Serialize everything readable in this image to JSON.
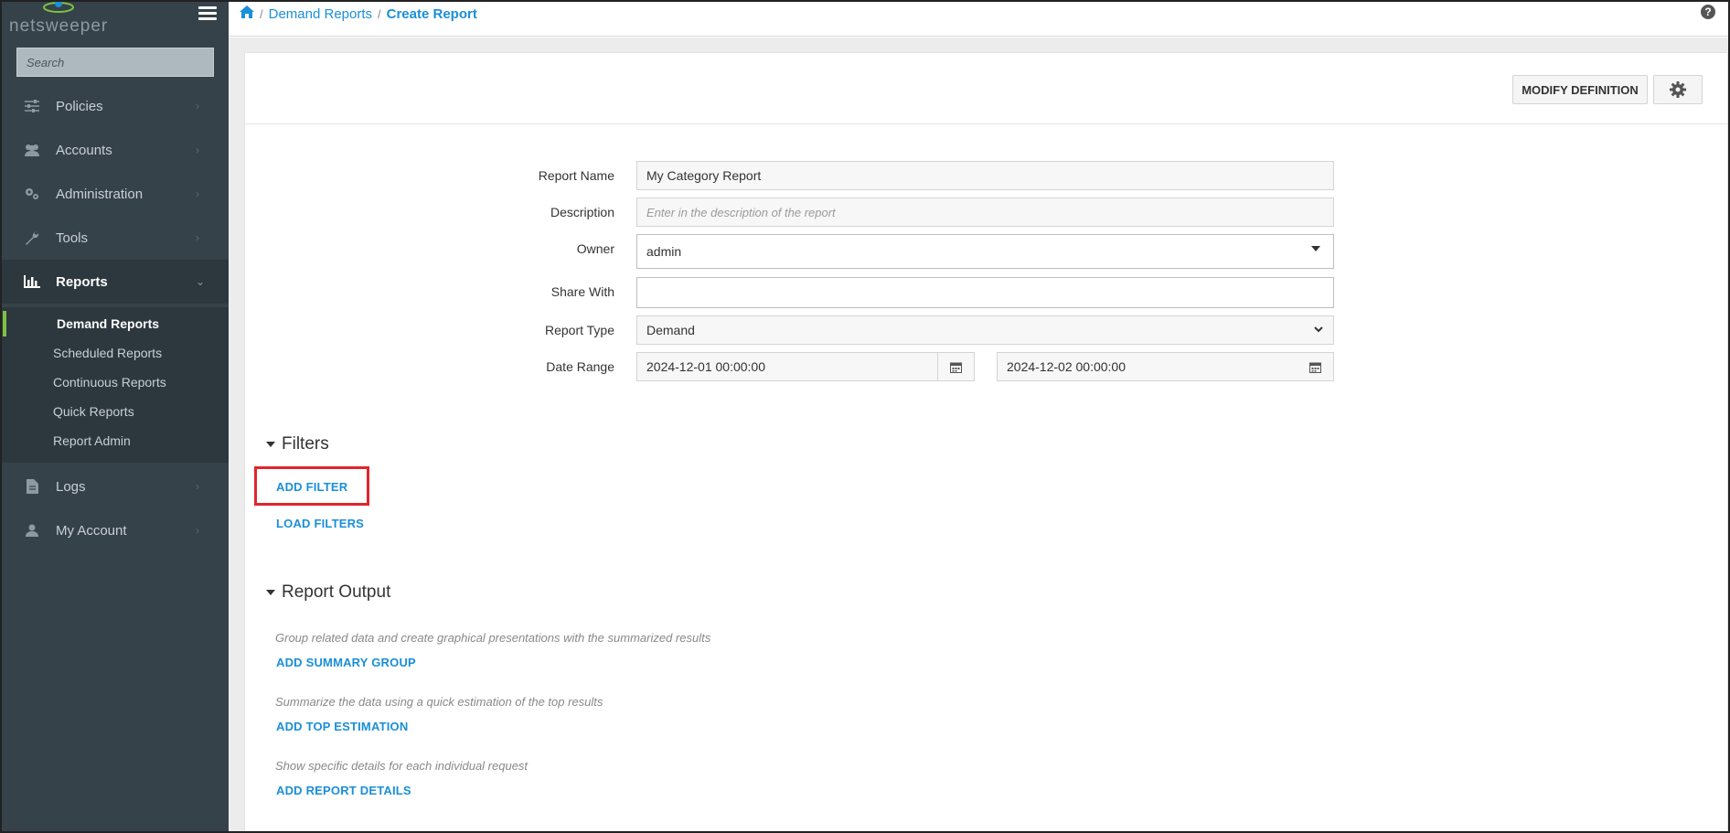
{
  "brand": {
    "name": "netsweeper"
  },
  "sidebar": {
    "search_placeholder": "Search",
    "items": [
      {
        "label": "Policies",
        "icon": "sliders-icon"
      },
      {
        "label": "Accounts",
        "icon": "users-icon"
      },
      {
        "label": "Administration",
        "icon": "cogs-icon"
      },
      {
        "label": "Tools",
        "icon": "wrench-icon"
      },
      {
        "label": "Reports",
        "icon": "bar-chart-icon"
      },
      {
        "label": "Logs",
        "icon": "file-icon"
      },
      {
        "label": "My Account",
        "icon": "user-icon"
      }
    ],
    "reports_submenu": [
      "Demand Reports",
      "Scheduled Reports",
      "Continuous Reports",
      "Quick Reports",
      "Report Admin"
    ]
  },
  "breadcrumb": {
    "items": [
      "Demand Reports"
    ],
    "current": "Create Report",
    "separator": "/"
  },
  "toolbar": {
    "modify_definition": "MODIFY DEFINITION"
  },
  "form": {
    "report_name": {
      "label": "Report Name",
      "value": "My Category Report"
    },
    "description": {
      "label": "Description",
      "placeholder": "Enter in the description of the report"
    },
    "owner": {
      "label": "Owner",
      "value": "admin"
    },
    "share_with": {
      "label": "Share With",
      "value": ""
    },
    "report_type": {
      "label": "Report Type",
      "value": "Demand"
    },
    "date_range": {
      "label": "Date Range",
      "start": "2024-12-01 00:00:00",
      "end": "2024-12-02 00:00:00"
    }
  },
  "filters": {
    "title": "Filters",
    "add_filter": "ADD FILTER",
    "load_filters": "LOAD FILTERS"
  },
  "report_output": {
    "title": "Report Output",
    "summary_hint": "Group related data and create graphical presentations with the summarized results",
    "add_summary_group": "ADD SUMMARY GROUP",
    "top_hint": "Summarize the data using a quick estimation of the top results",
    "add_top_estimation": "ADD TOP ESTIMATION",
    "details_hint": "Show specific details for each individual request",
    "add_report_details": "ADD REPORT DETAILS"
  },
  "colors": {
    "accent": "#1a8fd8",
    "sidebar": "#35424a",
    "active_bar": "#7fc241",
    "highlight": "#e2242b"
  }
}
